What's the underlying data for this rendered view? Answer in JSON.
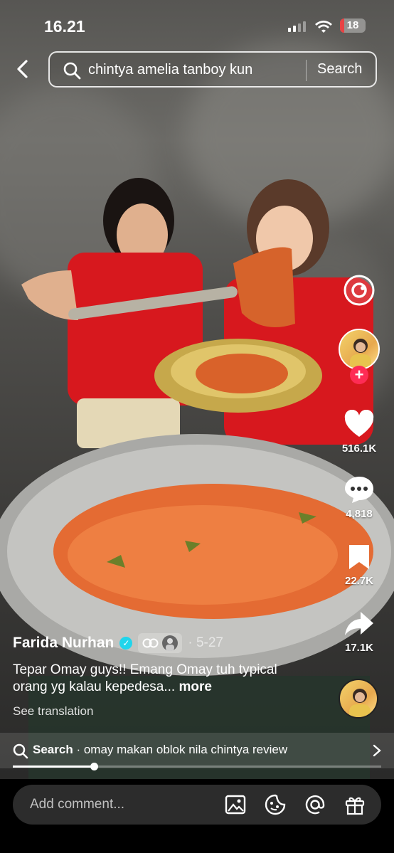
{
  "status": {
    "time": "16.21",
    "battery": "18"
  },
  "search": {
    "query": "chintya amelia tanboy kun",
    "button": "Search"
  },
  "rail": {
    "likes": "516.1K",
    "comments": "4,818",
    "saves": "22.7K",
    "shares": "17.1K"
  },
  "post": {
    "author": "Farida Nurhan",
    "date": "· 5-27",
    "caption": "Tepar Omay guys!! Emang Omay tuh typical orang yg kalau kepedesa...",
    "more": "more",
    "translate": "See translation"
  },
  "suggest": {
    "label": "Search",
    "text": "· omay makan oblok nila chintya review"
  },
  "video": {
    "progress": 0.22
  },
  "comment": {
    "placeholder": "Add comment..."
  },
  "colors": {
    "like": "#ffffff",
    "follow": "#fe2c55",
    "verified": "#20d5ec"
  },
  "icons": [
    "back-icon",
    "search-icon",
    "sticker-icon",
    "heart-icon",
    "comment-icon",
    "bookmark-icon",
    "share-icon",
    "image-icon",
    "emoji-icon",
    "mention-icon",
    "gift-icon"
  ]
}
